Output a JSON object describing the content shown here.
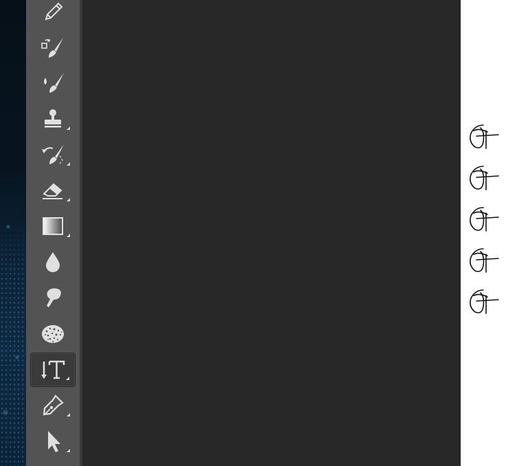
{
  "toolbar": {
    "tools": [
      {
        "name": "pencil-tool",
        "icon": "pencil-icon",
        "has_submenu": false
      },
      {
        "name": "color-replacement-tool",
        "icon": "color-replacement-icon",
        "has_submenu": false
      },
      {
        "name": "mixer-brush-tool",
        "icon": "mixer-brush-icon",
        "has_submenu": false
      },
      {
        "name": "clone-stamp-tool",
        "icon": "stamp-icon",
        "has_submenu": true
      },
      {
        "name": "history-brush-tool",
        "icon": "history-brush-icon",
        "has_submenu": true
      },
      {
        "name": "eraser-tool",
        "icon": "eraser-icon",
        "has_submenu": true
      },
      {
        "name": "gradient-tool",
        "icon": "gradient-icon",
        "has_submenu": true
      },
      {
        "name": "blur-tool",
        "icon": "blur-drop-icon",
        "has_submenu": false
      },
      {
        "name": "smudge-tool",
        "icon": "smudge-finger-icon",
        "has_submenu": false
      },
      {
        "name": "sponge-tool",
        "icon": "sponge-icon",
        "has_submenu": false
      },
      {
        "name": "vertical-type-tool",
        "icon": "vertical-type-icon",
        "has_submenu": true,
        "active": true
      },
      {
        "name": "pen-tool",
        "icon": "pen-nib-icon",
        "has_submenu": true
      },
      {
        "name": "path-selection-tool",
        "icon": "arrow-pointer-icon",
        "has_submenu": true
      }
    ]
  },
  "document": {
    "glyph_count": 5,
    "glyph_icon": "script-glyph"
  },
  "colors": {
    "toolbar_bg": "#535353",
    "workspace_bg": "#282828",
    "icon": "#e0e0e0",
    "active_tool_bg": "#3a3a3a",
    "document_bg": "#ffffff"
  }
}
